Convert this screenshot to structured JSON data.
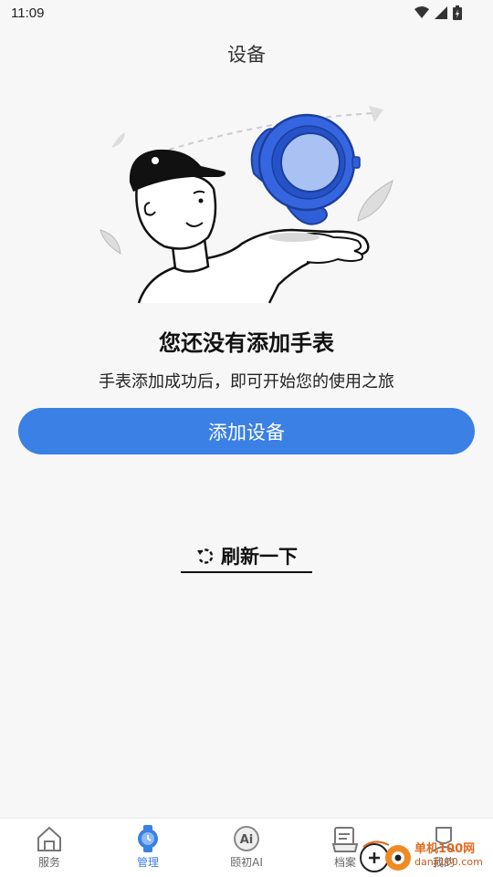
{
  "status": {
    "time": "11:09"
  },
  "header": {
    "title": "设备"
  },
  "empty": {
    "title": "您还没有添加手表",
    "description": "手表添加成功后，即可开始您的使用之旅"
  },
  "actions": {
    "add_device_label": "添加设备",
    "refresh_label": "刷新一下"
  },
  "tabs": [
    {
      "label": "服务",
      "icon": "home-icon",
      "active": false
    },
    {
      "label": "管理",
      "icon": "watch-icon",
      "active": true
    },
    {
      "label": "颐初AI",
      "icon": "ai-icon",
      "active": false
    },
    {
      "label": "档案",
      "icon": "archive-icon",
      "active": false
    },
    {
      "label": "我的",
      "icon": "profile-icon",
      "active": false
    }
  ],
  "watermark": {
    "line1": "单机100网",
    "line2": "danji100.com"
  },
  "colors": {
    "accent": "#3b80e4",
    "background": "#f7f7f7",
    "watch": "#2f5fd6"
  }
}
